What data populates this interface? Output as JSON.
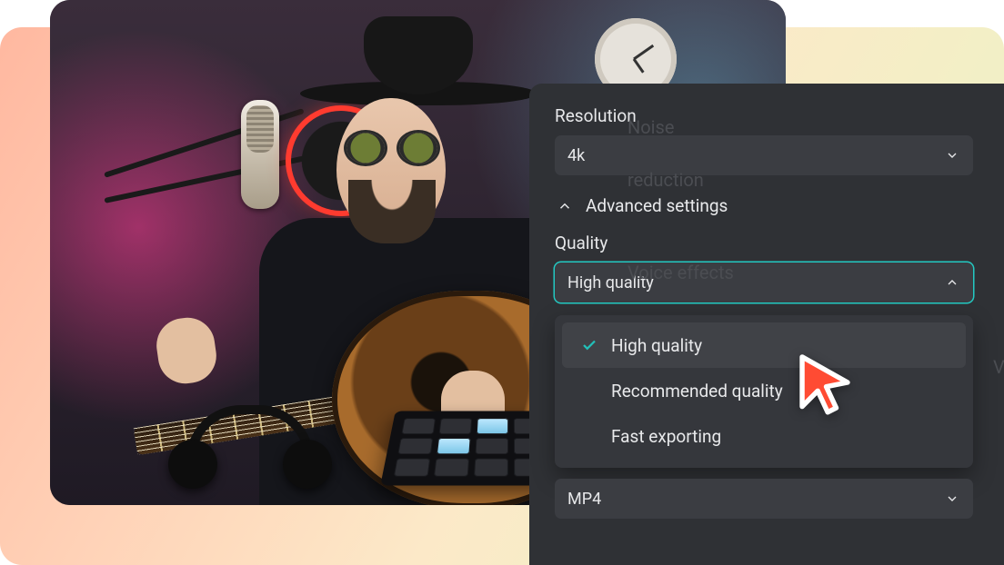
{
  "panel": {
    "resolution": {
      "label": "Resolution",
      "value": "4k"
    },
    "advanced_label": "Advanced settings",
    "quality": {
      "label": "Quality",
      "value": "High quality",
      "options": [
        "High quality",
        "Recommended quality",
        "Fast exporting"
      ],
      "selected_index": 0
    },
    "format": {
      "value": "MP4"
    },
    "ghost_labels": {
      "noise": "Noise",
      "reduction": "reduction",
      "voice": "Voice effects",
      "v": "V"
    }
  },
  "colors": {
    "accent": "#23c9c2",
    "panel_bg": "#2f3135",
    "field_bg": "#3b3d42"
  }
}
